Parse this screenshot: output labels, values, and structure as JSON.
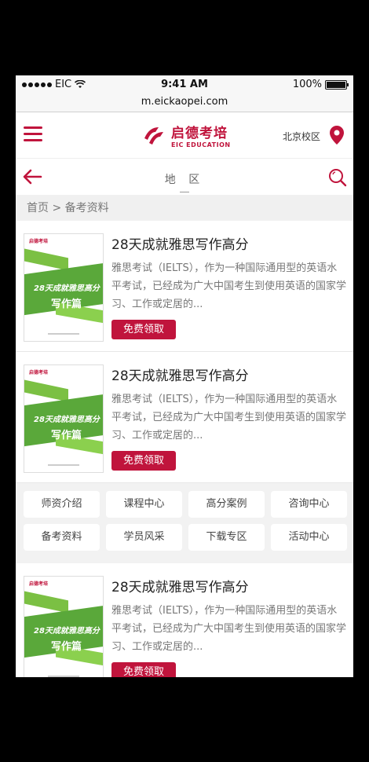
{
  "status_bar": {
    "carrier": "EIC",
    "time": "9:41 AM",
    "battery": "100%"
  },
  "url": "m.eickaopei.com",
  "header": {
    "logo_cn": "启德考培",
    "logo_en": "EIC EDUCATION",
    "campus": "北京校区"
  },
  "tabbar": {
    "label": "地 区"
  },
  "breadcrumb": "首页 > 备考资料",
  "items": [
    {
      "title": "28天成就雅思写作高分",
      "desc": "雅思考试（IELTS），作为一种国际通用型的英语水平考试，已经成为广大中国考生到使用英语的国家学习、工作或定居的...",
      "button": "免费领取",
      "cover_brand": "启德考培",
      "cover_line1": "28天成就雅思高分",
      "cover_line2": "写作篇"
    },
    {
      "title": "28天成就雅思写作高分",
      "desc": "雅思考试（IELTS），作为一种国际通用型的英语水平考试，已经成为广大中国考生到使用英语的国家学习、工作或定居的...",
      "button": "免费领取",
      "cover_brand": "启德考培",
      "cover_line1": "28天成就雅思高分",
      "cover_line2": "写作篇"
    },
    {
      "title": "28天成就雅思写作高分",
      "desc": "雅思考试（IELTS），作为一种国际通用型的英语水平考试，已经成为广大中国考生到使用英语的国家学习、工作或定居的...",
      "button": "免费领取",
      "cover_brand": "启德考培",
      "cover_line1": "28天成就雅思高分",
      "cover_line2": "写作篇"
    }
  ],
  "nav": [
    "师资介绍",
    "课程中心",
    "高分案例",
    "咨询中心",
    "备考资料",
    "学员风采",
    "下载专区",
    "活动中心"
  ],
  "colors": {
    "accent": "#c0143c",
    "green": "#5aa83a"
  }
}
